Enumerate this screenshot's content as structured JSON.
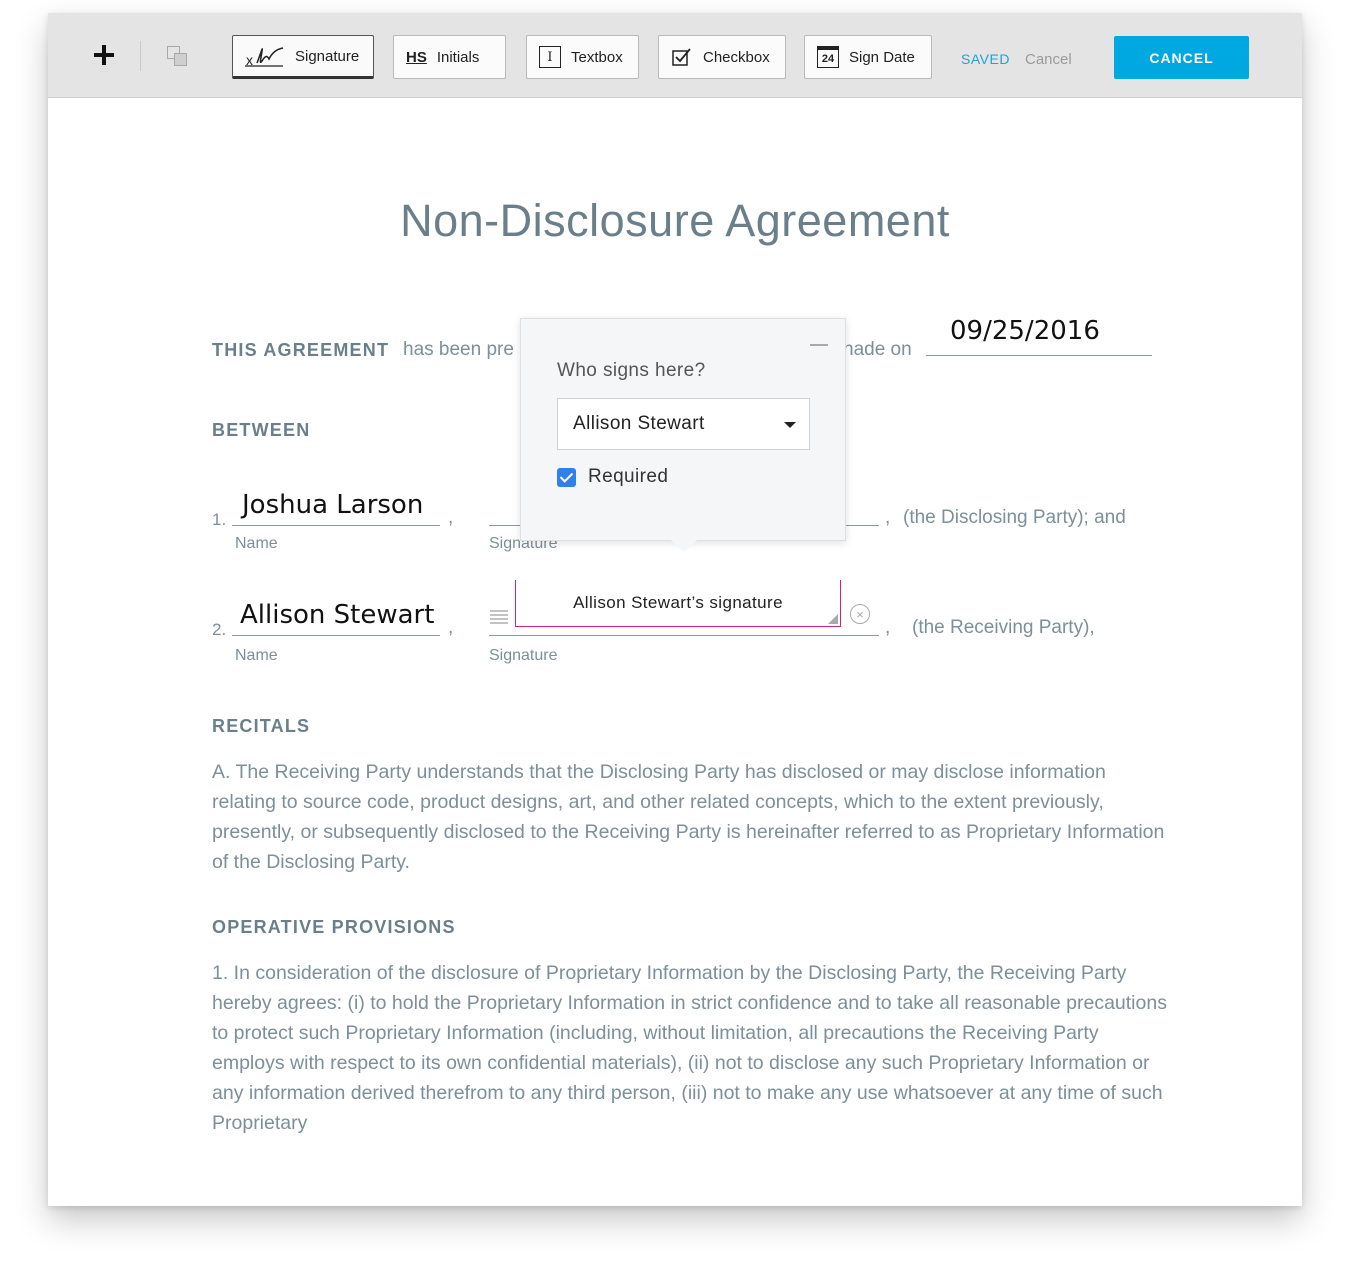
{
  "toolbar": {
    "add_label": "+",
    "tools": [
      {
        "label": "Signature",
        "icon": "signature-icon"
      },
      {
        "label": "Initials",
        "icon": "initials-icon",
        "icon_text": "HS"
      },
      {
        "label": "Textbox",
        "icon": "textbox-icon",
        "icon_text": "I"
      },
      {
        "label": "Checkbox",
        "icon": "checkbox-icon"
      },
      {
        "label": "Sign Date",
        "icon": "calendar-icon",
        "icon_text": "24"
      }
    ],
    "saved_label": "SAVED",
    "cancel_link": "Cancel",
    "cancel_button": "CANCEL"
  },
  "document": {
    "title": "Non-Disclosure Agreement",
    "agreement_heading": "THIS AGREEMENT",
    "agreement_text_start": "has been pre",
    "agreement_text_end": "nade on",
    "date_value": "09/25/2016",
    "between_heading": "BETWEEN",
    "parties": [
      {
        "num": "1.",
        "name": "Joshua Larson",
        "role": "(the Disclosing Party); and"
      },
      {
        "num": "2.",
        "name": "Allison Stewart",
        "role": "(the Receiving Party),"
      }
    ],
    "name_label": "Name",
    "signature_label": "Signature",
    "comma": ",",
    "signature_field_text": "Allison Stewart’s signature",
    "recitals_heading": "RECITALS",
    "recitals_text": "A. The Receiving Party understands that the Disclosing Party has disclosed or may disclose information relating to source code, product designs, art, and other related concepts, which to the extent previously, presently, or subsequently disclosed to the Receiving Party is hereinafter referred to as Proprietary Information of the Disclosing Party.",
    "provisions_heading": "OPERATIVE PROVISIONS",
    "provisions_text": "1. In consideration of the disclosure of Proprietary Information by the Disclosing Party, the Receiving Party hereby agrees: (i) to hold the Proprietary Information in strict confidence and to take all reasonable precautions to protect such Proprietary Information (including, without limitation, all precautions the Receiving Party employs with respect to its own confidential materials), (ii) not to disclose any such Proprietary Information or any information derived therefrom to any third person, (iii) not to make any use whatsoever at any time of such Proprietary"
  },
  "popover": {
    "question": "Who signs here?",
    "selected_signer": "Allison Stewart",
    "required_label": "Required",
    "required_checked": true
  },
  "colors": {
    "accent": "#00a8e1",
    "saved": "#1fa3d8",
    "signature_field_border": "#d0217b",
    "checkbox": "#2f80ed"
  }
}
